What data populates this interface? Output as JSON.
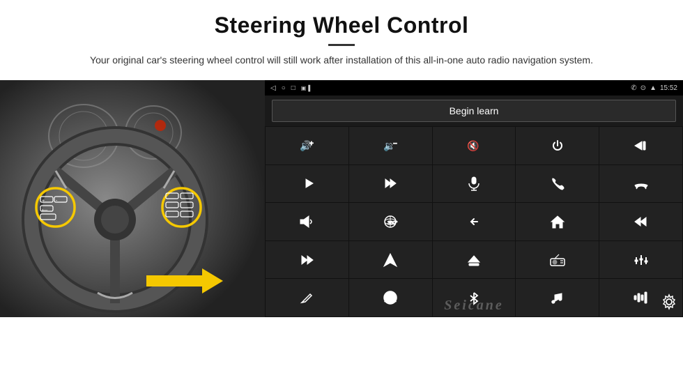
{
  "header": {
    "title": "Steering Wheel Control",
    "subtitle": "Your original car's steering wheel control will still work after installation of this all-in-one auto radio navigation system."
  },
  "status_bar": {
    "back_icon": "◁",
    "home_icon": "○",
    "recent_icon": "□",
    "media_icon": "▣▐",
    "phone_icon": "✆",
    "location_icon": "⊙",
    "wifi_icon": "▲",
    "time": "15:52"
  },
  "begin_learn_button": "Begin learn",
  "icon_grid": [
    {
      "id": "vol-up",
      "label": "Volume Up"
    },
    {
      "id": "vol-down",
      "label": "Volume Down"
    },
    {
      "id": "vol-mute",
      "label": "Volume Mute"
    },
    {
      "id": "power",
      "label": "Power"
    },
    {
      "id": "prev-track",
      "label": "Previous Track"
    },
    {
      "id": "next-track",
      "label": "Next Track"
    },
    {
      "id": "fast-forward",
      "label": "Fast Forward"
    },
    {
      "id": "mic",
      "label": "Microphone"
    },
    {
      "id": "phone-call",
      "label": "Phone Call"
    },
    {
      "id": "hang-up",
      "label": "Hang Up"
    },
    {
      "id": "horn",
      "label": "Horn"
    },
    {
      "id": "360-view",
      "label": "360 View"
    },
    {
      "id": "back",
      "label": "Back"
    },
    {
      "id": "home",
      "label": "Home"
    },
    {
      "id": "skip-back",
      "label": "Skip Back"
    },
    {
      "id": "skip-fwd",
      "label": "Skip Forward"
    },
    {
      "id": "navigate",
      "label": "Navigate"
    },
    {
      "id": "eject",
      "label": "Eject"
    },
    {
      "id": "radio",
      "label": "Radio"
    },
    {
      "id": "settings-eq",
      "label": "Settings EQ"
    },
    {
      "id": "pen",
      "label": "Pen"
    },
    {
      "id": "steering",
      "label": "Steering"
    },
    {
      "id": "bluetooth",
      "label": "Bluetooth"
    },
    {
      "id": "music",
      "label": "Music"
    },
    {
      "id": "equalizer",
      "label": "Equalizer"
    }
  ],
  "watermark": "Seicane",
  "colors": {
    "background": "#ffffff",
    "screen_bg": "#1a1a1a",
    "icon_bg": "#222222",
    "icon_color": "#ffffff",
    "title_color": "#111111"
  }
}
